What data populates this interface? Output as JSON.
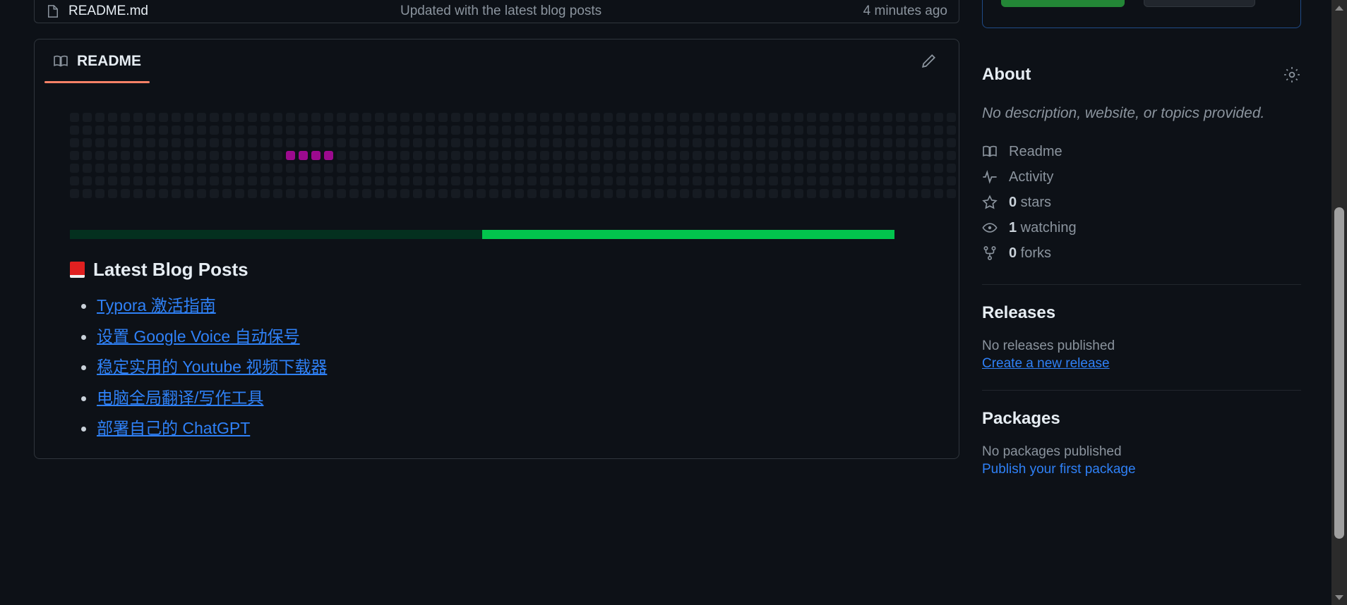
{
  "file_row": {
    "icon": "file-icon",
    "name": "README.md",
    "commit_message": "Updated with the latest blog posts",
    "time": "4 minutes ago"
  },
  "readme": {
    "tab_label": "README",
    "tab_icon": "book-icon",
    "edit_icon": "pencil-icon",
    "heading": "Latest Blog Posts",
    "heading_emoji": "closed-book-emoji",
    "links": [
      "Typora 激活指南",
      "设置 Google Voice 自动保号",
      "稳定实用的 Youtube 视频下载器",
      "电脑全局翻译/写作工具",
      "部署自己的 ChatGPT"
    ]
  },
  "snake_graph": {
    "rows": 7,
    "columns": 76,
    "empty_color": "#161b22",
    "active_color": "#9c0a8e",
    "active_cells": [
      {
        "col": 17,
        "row": 3
      },
      {
        "col": 18,
        "row": 3
      },
      {
        "col": 19,
        "row": 3
      },
      {
        "col": 20,
        "row": 3
      }
    ],
    "short_columns": [
      {
        "col": 74,
        "rows": 4
      },
      {
        "col": 75,
        "rows": 7
      }
    ]
  },
  "progress_bar": {
    "dark_color": "#04301f",
    "light_color": "#02c44d",
    "dark_percent": 50,
    "light_percent": 50
  },
  "top_buttons": {
    "primary_color": "#238636",
    "secondary_color": "#21262d"
  },
  "sidebar": {
    "about": {
      "title": "About",
      "gear_icon": "gear-icon",
      "description": "No description, website, or topics provided.",
      "meta": [
        {
          "icon": "book-icon",
          "label": "Readme",
          "value": ""
        },
        {
          "icon": "pulse-icon",
          "label": "Activity",
          "value": ""
        },
        {
          "icon": "star-icon",
          "label": "stars",
          "value": "0"
        },
        {
          "icon": "eye-icon",
          "label": "watching",
          "value": "1"
        },
        {
          "icon": "fork-icon",
          "label": "forks",
          "value": "0"
        }
      ]
    },
    "releases": {
      "title": "Releases",
      "note": "No releases published",
      "link": "Create a new release"
    },
    "packages": {
      "title": "Packages",
      "note": "No packages published",
      "link": "Publish your first package"
    }
  },
  "scrollbar": {
    "up_icon": "scroll-up-arrow",
    "down_icon": "scroll-down-arrow"
  }
}
